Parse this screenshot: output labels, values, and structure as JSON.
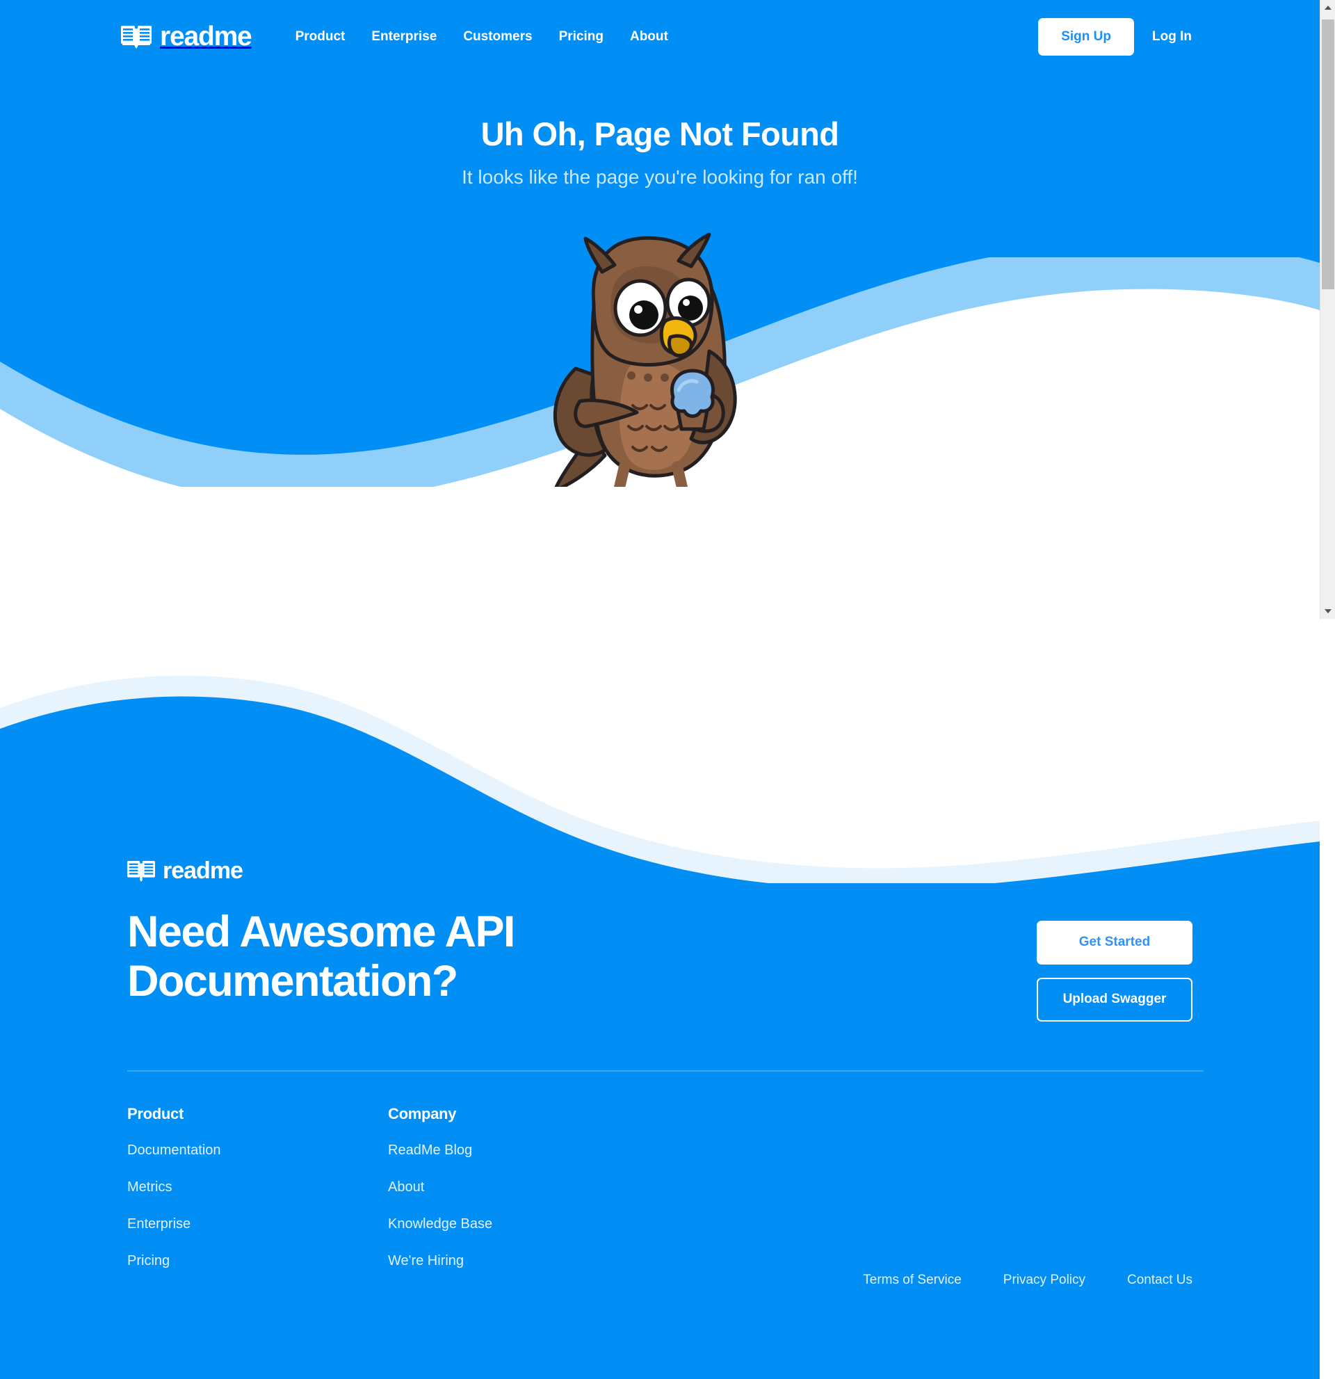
{
  "brand": {
    "name": "readme",
    "primary_color": "#018ef5",
    "light_wave_color": "#8fcffa",
    "pale_wave_color": "#e8f4fd",
    "white": "#ffffff"
  },
  "nav": {
    "logo_text": "readme",
    "logo_icon": "open-book-icon",
    "links": [
      {
        "label": "Product"
      },
      {
        "label": "Enterprise"
      },
      {
        "label": "Customers"
      },
      {
        "label": "Pricing"
      },
      {
        "label": "About"
      }
    ],
    "signup_label": "Sign Up",
    "login_label": "Log In"
  },
  "hero": {
    "title": "Uh Oh, Page Not Found",
    "subtitle": "It looks like the page you're looking for ran off!",
    "illustration": "owl-mascot-with-cupcake-illustration"
  },
  "footer": {
    "logo_text": "readme",
    "logo_icon": "open-book-icon",
    "cta_heading": "Need Awesome API Documentation?",
    "get_started_label": "Get Started",
    "upload_swagger_label": "Upload Swagger",
    "columns": [
      {
        "title": "Product",
        "links": [
          {
            "label": "Documentation"
          },
          {
            "label": "Metrics"
          },
          {
            "label": "Enterprise"
          },
          {
            "label": "Pricing"
          }
        ]
      },
      {
        "title": "Company",
        "links": [
          {
            "label": "ReadMe Blog"
          },
          {
            "label": "About"
          },
          {
            "label": "Knowledge Base"
          },
          {
            "label": "We're Hiring"
          }
        ]
      }
    ],
    "legal": [
      {
        "label": "Terms of Service"
      },
      {
        "label": "Privacy Policy"
      },
      {
        "label": "Contact Us"
      }
    ]
  },
  "scrollbar": {
    "up_arrow": "scroll-up-arrow-icon",
    "down_arrow": "scroll-down-arrow-icon"
  }
}
